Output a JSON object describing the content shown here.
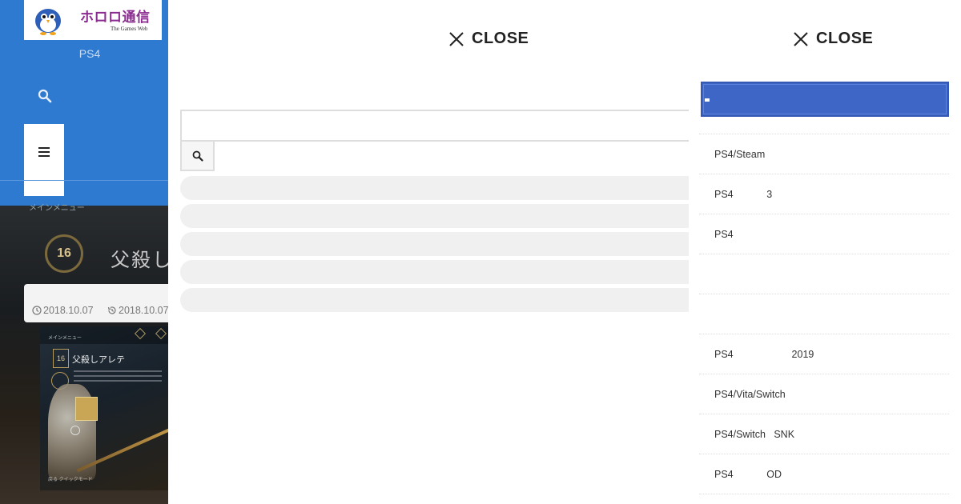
{
  "site": {
    "logo_text": "ホロロ通信",
    "logo_sub": "The Games Web",
    "category": "PS4"
  },
  "article": {
    "game_menu": "メインメニュー",
    "game_badge": "16",
    "game_title": "父殺し",
    "posted_date": "2018.10.07",
    "updated_date": "2018.10.07",
    "screenshot": {
      "menu": "メインメニュー",
      "badge": "16",
      "title": "父殺しアレテ",
      "footer": "戻る  クイックモード"
    }
  },
  "search": {
    "close_label": "CLOSE",
    "input_value": "",
    "input_placeholder": "",
    "suggestions": [
      "",
      "",
      "",
      "",
      ""
    ]
  },
  "menu": {
    "close_label": "CLOSE",
    "active_label": "",
    "items": [
      "",
      "PS4/Steam",
      "PS4            3",
      "PS4",
      "",
      "",
      "PS4                     2019",
      "PS4/Vita/Switch",
      "PS4/Switch   SNK",
      "PS4            OD"
    ]
  },
  "colors": {
    "header_blue": "#2f7ad1",
    "active_menu": "#3d66c7",
    "logo_text": "#8a2b8f"
  }
}
